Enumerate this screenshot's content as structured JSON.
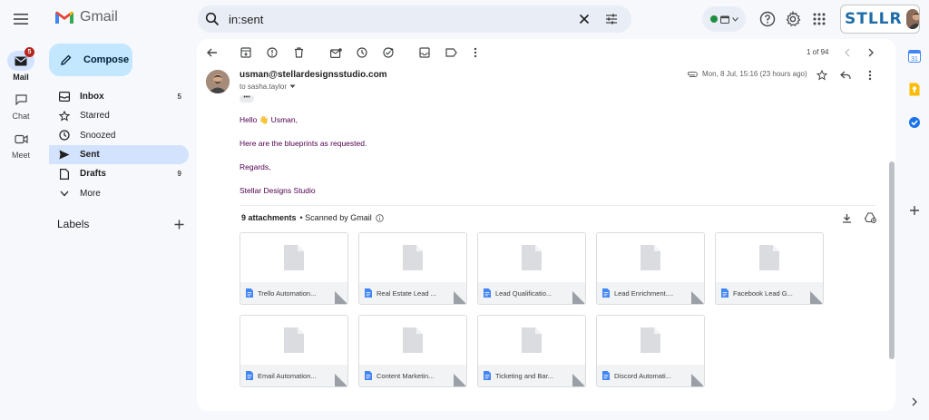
{
  "app": {
    "logo_text": "Gmail"
  },
  "rail": {
    "mail_label": "Mail",
    "mail_badge": "5",
    "chat_label": "Chat",
    "meet_label": "Meet"
  },
  "search": {
    "query": "in:sent"
  },
  "brand": {
    "text": "STLLR"
  },
  "compose": {
    "label": "Compose"
  },
  "nav": {
    "items": [
      {
        "label": "Inbox",
        "count": "5"
      },
      {
        "label": "Starred",
        "count": ""
      },
      {
        "label": "Snoozed",
        "count": ""
      },
      {
        "label": "Sent",
        "count": ""
      },
      {
        "label": "Drafts",
        "count": "9"
      },
      {
        "label": "More",
        "count": ""
      }
    ],
    "labels_heading": "Labels"
  },
  "toolbar": {
    "pager": "1 of 94"
  },
  "message": {
    "sender": "usman@stellardesignsstudio.com",
    "to": "to sasha.taylor",
    "date": "Mon, 8 Jul, 15:16 (23 hours ago)",
    "body": {
      "greeting": "Hello 👋 Usman,",
      "line1": "Here are the blueprints as requested.",
      "regards": "Regards,",
      "signature": "Stellar Designs Studio"
    },
    "attachments_count": "9 attachments",
    "scanned": "• Scanned by Gmail",
    "attachments": [
      "Trello Automation...",
      "Real Estate Lead ...",
      "Lead Qualificatio...",
      "Lead Enrichment....",
      "Facebook Lead G...",
      "Email Automation...",
      "Content Marketin...",
      "Ticketing and Bar...",
      "Discord Automati..."
    ]
  },
  "colors": {
    "compose_bg": "#c2e7ff",
    "active_nav": "#d3e3fd",
    "body_text": "#500050",
    "brand": "#1e6ca8",
    "badge": "#b3261e"
  }
}
